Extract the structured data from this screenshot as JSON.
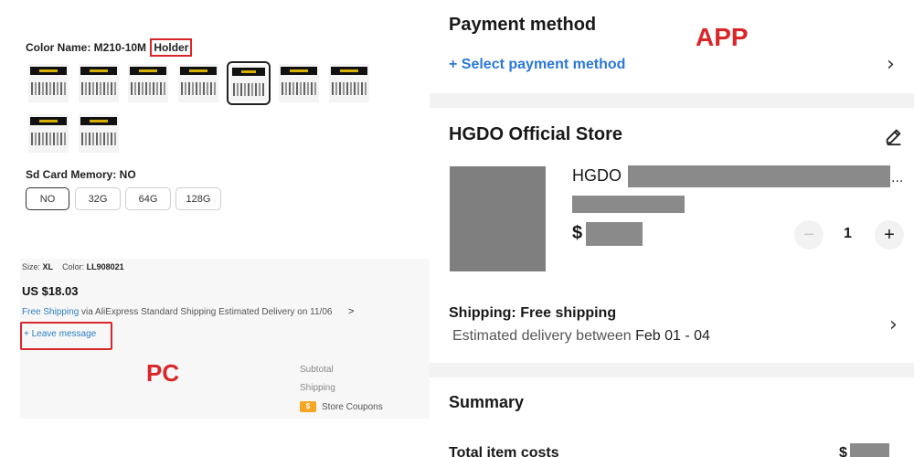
{
  "pc": {
    "color_name_label": "Color Name: M210-10M",
    "color_name_highlight": "Holder",
    "sd_card_label": "Sd Card Memory: NO",
    "sd_options": [
      "NO",
      "32G",
      "64G",
      "128G"
    ],
    "sd_selected": "NO",
    "size_label": "Size:",
    "size_value": "XL",
    "color_label": "Color:",
    "color_value": "LL908021",
    "price": "US $18.03",
    "free_shipping": "Free Shipping",
    "shipping_text": " via AliExpress Standard Shipping  Estimated Delivery on 11/06",
    "chevron": ">",
    "leave_message": "+ Leave message",
    "annotation_label": "PC",
    "subtotal_label": "Subtotal",
    "shipping_label": "Shipping",
    "coupon_icon": "$",
    "store_coupons_label": "Store Coupons"
  },
  "app": {
    "payment_title": "Payment method",
    "annotation_label": "APP",
    "select_payment": "+ Select payment method",
    "store_name": "HGDO Official Store",
    "product_name": "HGDO",
    "ellipsis": "...",
    "currency": "$",
    "quantity": "1",
    "minus": "−",
    "plus": "+",
    "shipping_title": "Shipping: Free shipping",
    "estimated_prefix": "Estimated delivery between ",
    "estimated_dates": "Feb 01 - 04",
    "summary_title": "Summary",
    "total_label": "Total item costs",
    "total_currency": "$",
    "chevron": "›",
    "icons": [
      "chevron-right-icon",
      "edit-pencil-icon",
      "minus-icon",
      "plus-icon"
    ]
  },
  "colors": {
    "annotation_red": "#d9262a",
    "link_blue": "#2b78d6",
    "pc_link_blue": "#2f7fc4",
    "coupon_orange": "#f5a623"
  }
}
